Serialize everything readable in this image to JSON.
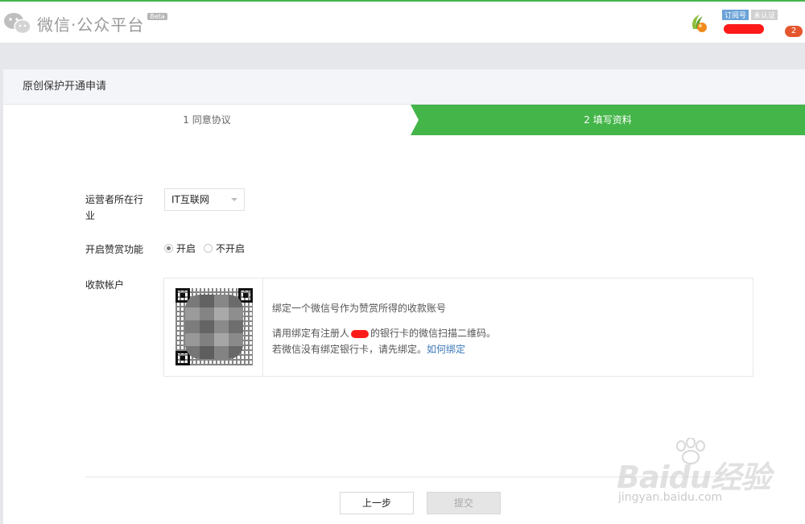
{
  "header": {
    "logo_text": "微信·公众平台",
    "beta_label": "Beta",
    "account_type_badge": "订阅号",
    "verification_badge": "未认证",
    "notification_count": "2"
  },
  "page": {
    "title": "原创保护开通申请"
  },
  "steps": [
    {
      "label": "1 同意协议",
      "state": "done"
    },
    {
      "label": "2 填写资料",
      "state": "active"
    }
  ],
  "form": {
    "industry_label": "运营者所在行业",
    "industry_value": "IT互联网",
    "reward_label": "开启赞赏功能",
    "reward_options": [
      {
        "label": "开启",
        "selected": true
      },
      {
        "label": "不开启",
        "selected": false
      }
    ],
    "account_label": "收款帐户",
    "qr_line1": "绑定一个微信号作为赞赏所得的收款账号",
    "qr_line2_before": "请用绑定有注册人",
    "qr_line2_after": "的银行卡的微信扫描二维码。",
    "qr_line3": "若微信没有绑定银行卡，请先绑定。",
    "qr_link": "如何绑定"
  },
  "buttons": {
    "prev_label": "上一步",
    "submit_label": "提交"
  },
  "watermark": {
    "main": "Baidu经验",
    "sub": "jingyan.baidu.com"
  },
  "colors": {
    "brand_green": "#44b549",
    "link_blue": "#3b78b8",
    "badge_red": "#e5562e"
  }
}
